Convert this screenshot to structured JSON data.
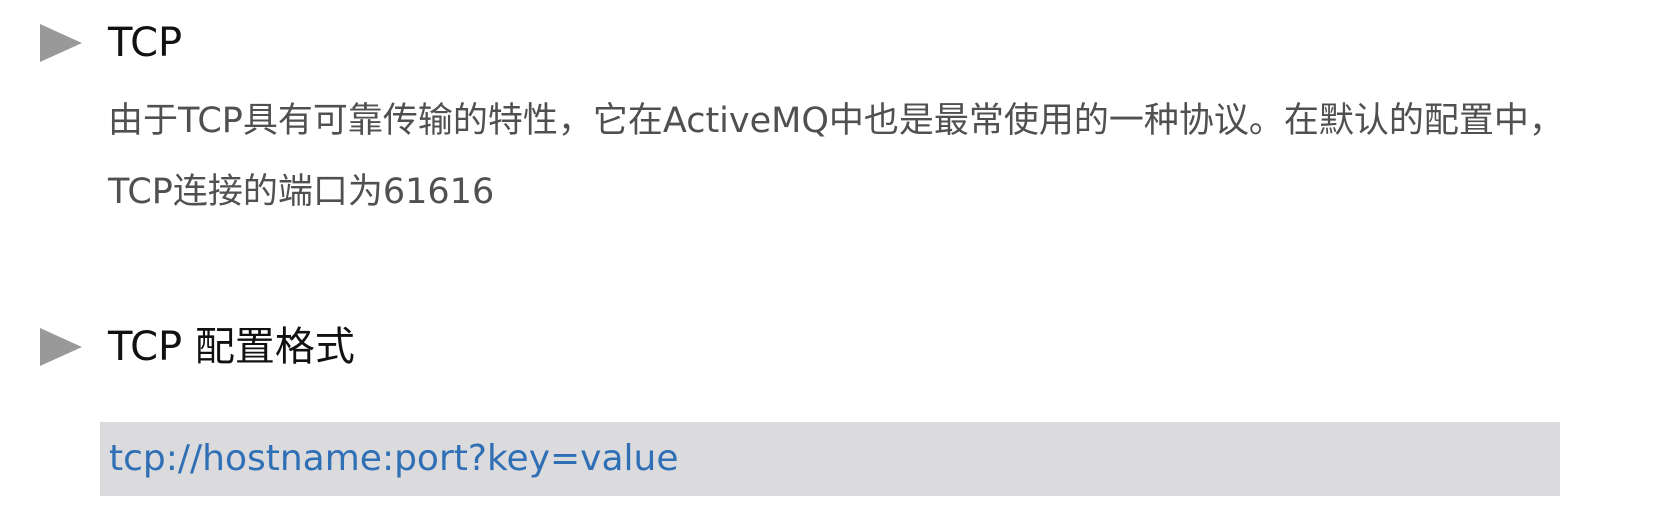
{
  "sections": [
    {
      "heading": "TCP",
      "paragraph": "由于TCP具有可靠传输的特性，它在ActiveMQ中也是最常使用的一种协议。在默认的配置中，TCP连接的端口为61616"
    },
    {
      "heading": "TCP 配置格式",
      "code": "tcp://hostname:port?key=value"
    }
  ],
  "colors": {
    "bullet": "#999999",
    "heading": "#111111",
    "body_text": "#505050",
    "code_background": "#dbdbdd",
    "code_text": "#2f6fb5"
  },
  "icons": {
    "bullet": "triangle-right-icon"
  }
}
